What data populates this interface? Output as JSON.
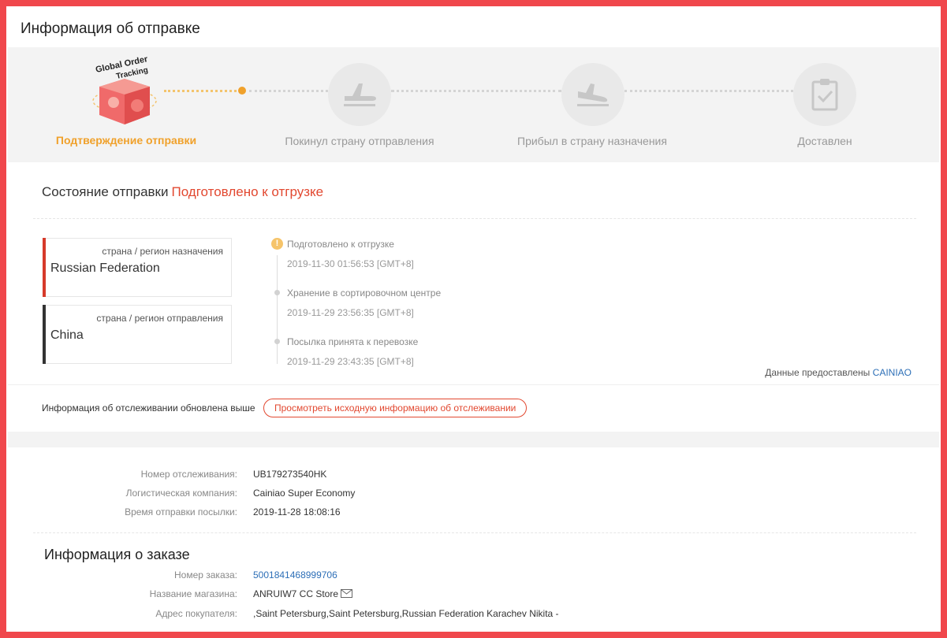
{
  "page": {
    "title": "Информация об отправке"
  },
  "logo": {
    "text_line1": "Global Order",
    "text_line2": "Tracking"
  },
  "progress": {
    "steps": [
      {
        "label": "Подтверждение отправки",
        "state": "active",
        "icon": "global-order-tracking-logo"
      },
      {
        "label": "Покинул страну отправления",
        "state": "pending",
        "icon": "plane-takeoff-icon"
      },
      {
        "label": "Прибыл в страну назначения",
        "state": "pending",
        "icon": "plane-landing-icon"
      },
      {
        "label": "Доставлен",
        "state": "pending",
        "icon": "clipboard-check-icon"
      }
    ]
  },
  "status": {
    "label": "Состояние отправки",
    "value": "Подготовлено к отгрузке"
  },
  "countries": {
    "destination": {
      "caption": "страна / регион назначения",
      "name": "Russian Federation"
    },
    "origin": {
      "caption": "страна / регион отправления",
      "name": "China"
    }
  },
  "timeline": [
    {
      "text": "Подготовлено к отгрузке",
      "time": "2019-11-30 01:56:53 [GMT+8]",
      "marker": "!"
    },
    {
      "text": "Хранение в сортировочном центре",
      "time": "2019-11-29 23:56:35 [GMT+8]"
    },
    {
      "text": "Посылка принята к перевозке",
      "time": "2019-11-29 23:43:35 [GMT+8]"
    }
  ],
  "provider": {
    "label": "Данные предоставлены",
    "name": "CAINIAO"
  },
  "tracking_update": {
    "label": "Информация об отслеживании обновлена выше",
    "button": "Просмотреть исходную информацию об отслеживании"
  },
  "shipment": {
    "tracking_number_label": "Номер отслеживания:",
    "tracking_number": "UB179273540HK",
    "carrier_label": "Логистическая компания:",
    "carrier": "Cainiao Super Economy",
    "sent_time_label": "Время отправки посылки:",
    "sent_time": "2019-11-28 18:08:16"
  },
  "order": {
    "title": "Информация о заказе",
    "number_label": "Номер заказа:",
    "number": "5001841468999706",
    "store_label": "Название магазина:",
    "store": "ANRUIW7 CC Store",
    "address_label": "Адрес покупателя:",
    "address": ",Saint Petersburg,Saint Petersburg,Russian Federation Karachev Nikita -"
  },
  "colors": {
    "frame": "#f0474c",
    "accent": "#f0a12b",
    "status": "#e24830",
    "link": "#2d6fb7",
    "destination_bar": "#d63a2a",
    "origin_bar": "#333333"
  }
}
